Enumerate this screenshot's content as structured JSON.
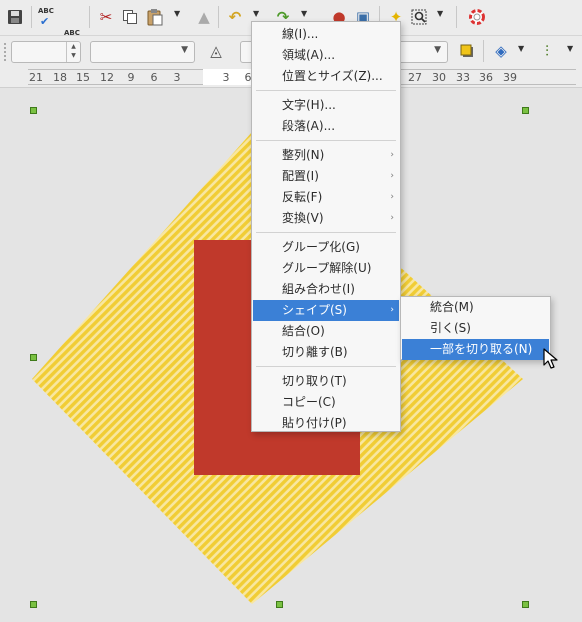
{
  "ruler": {
    "labels": [
      "21",
      "18",
      "15",
      "12",
      "9",
      "6",
      "3",
      "3",
      "6",
      "27",
      "30",
      "33",
      "36",
      "39"
    ]
  },
  "context_menu": {
    "items": [
      {
        "label": "線(I)..."
      },
      {
        "label": "領域(A)..."
      },
      {
        "label": "位置とサイズ(Z)..."
      },
      {
        "label": "文字(H)..."
      },
      {
        "label": "段落(A)..."
      },
      {
        "label": "整列(N)",
        "submenu": true
      },
      {
        "label": "配置(I)",
        "submenu": true
      },
      {
        "label": "反転(F)",
        "submenu": true
      },
      {
        "label": "変換(V)",
        "submenu": true
      },
      {
        "label": "グループ化(G)"
      },
      {
        "label": "グループ解除(U)"
      },
      {
        "label": "組み合わせ(I)"
      },
      {
        "label": "シェイプ(S)",
        "submenu": true,
        "highlighted": true
      },
      {
        "label": "結合(O)"
      },
      {
        "label": "切り離す(B)"
      },
      {
        "label": "切り取り(T)"
      },
      {
        "label": "コピー(C)"
      },
      {
        "label": "貼り付け(P)"
      }
    ]
  },
  "shape_submenu": {
    "items": [
      {
        "label": "統合(M)"
      },
      {
        "label": "引く(S)"
      },
      {
        "label": "一部を切り取る(N)",
        "highlighted": true
      }
    ]
  },
  "icons": {
    "toolbar1": [
      "save-icon",
      "spellcheck-icon",
      "autospellcheck-icon",
      "cut-icon",
      "copy-icon",
      "paste-icon",
      "clone-format-icon",
      "undo-icon",
      "redo-icon",
      "fontwork-icon",
      "image-icon",
      "glue-points-icon",
      "zoom-icon",
      "help-icon"
    ],
    "toolbar2": [
      "line-style-icon",
      "area-fill-icon",
      "shadow-icon",
      "transform-icon",
      "align-icon"
    ]
  },
  "colors": {
    "toolbar_bg": "#ececec",
    "canvas_bg": "#e4e4e4",
    "diamond_stripe_a": "#f1cd35",
    "diamond_stripe_b": "#f8e7a0",
    "red_rectangle": "#c0392b",
    "selection_handle": "#7ac142",
    "menu_highlight": "#3b80d6"
  }
}
